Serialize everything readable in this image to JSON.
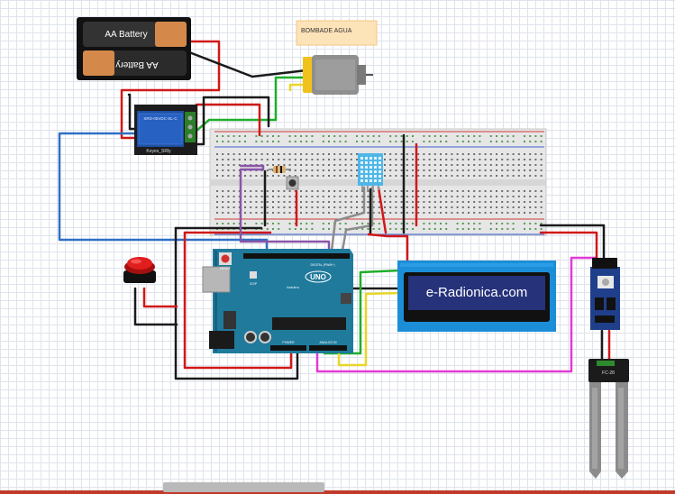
{
  "battery": {
    "top_label": "AA Battery",
    "bottom_label": "AA Battery"
  },
  "pump": {
    "label": "BOMBADE AGUA"
  },
  "relay": {
    "label": "Keyes_SRly",
    "model": "SRD-05VDC-SL-C"
  },
  "arduino": {
    "brand": "UNO",
    "sub": "Arduino",
    "reset": "RESET",
    "icsp": "ICSP",
    "digital": "DIGITAL (PWM~)",
    "power": "POWER",
    "analog": "ANALOG IN"
  },
  "lcd": {
    "text": "e-Radionica.com"
  },
  "moisture": {
    "label": "FC-28"
  },
  "colors": {
    "wire_red": "#d01818",
    "wire_black": "#1a1a1a",
    "wire_blue": "#2f6fc4",
    "wire_green": "#1fae2b",
    "wire_yellow": "#e8d62a",
    "wire_magenta": "#e23ad6",
    "wire_purple": "#8a55a8",
    "wire_gray": "#8c8c8c",
    "arduino_blue": "#1f7a9c",
    "lcd_frame": "#1c8ed8",
    "lcd_screen": "#26327a",
    "relay_blue": "#1d4fa3",
    "sensor_blue": "#4fb7e8",
    "motor_yellow": "#f1c21b",
    "battery_copper": "#d4894a"
  }
}
